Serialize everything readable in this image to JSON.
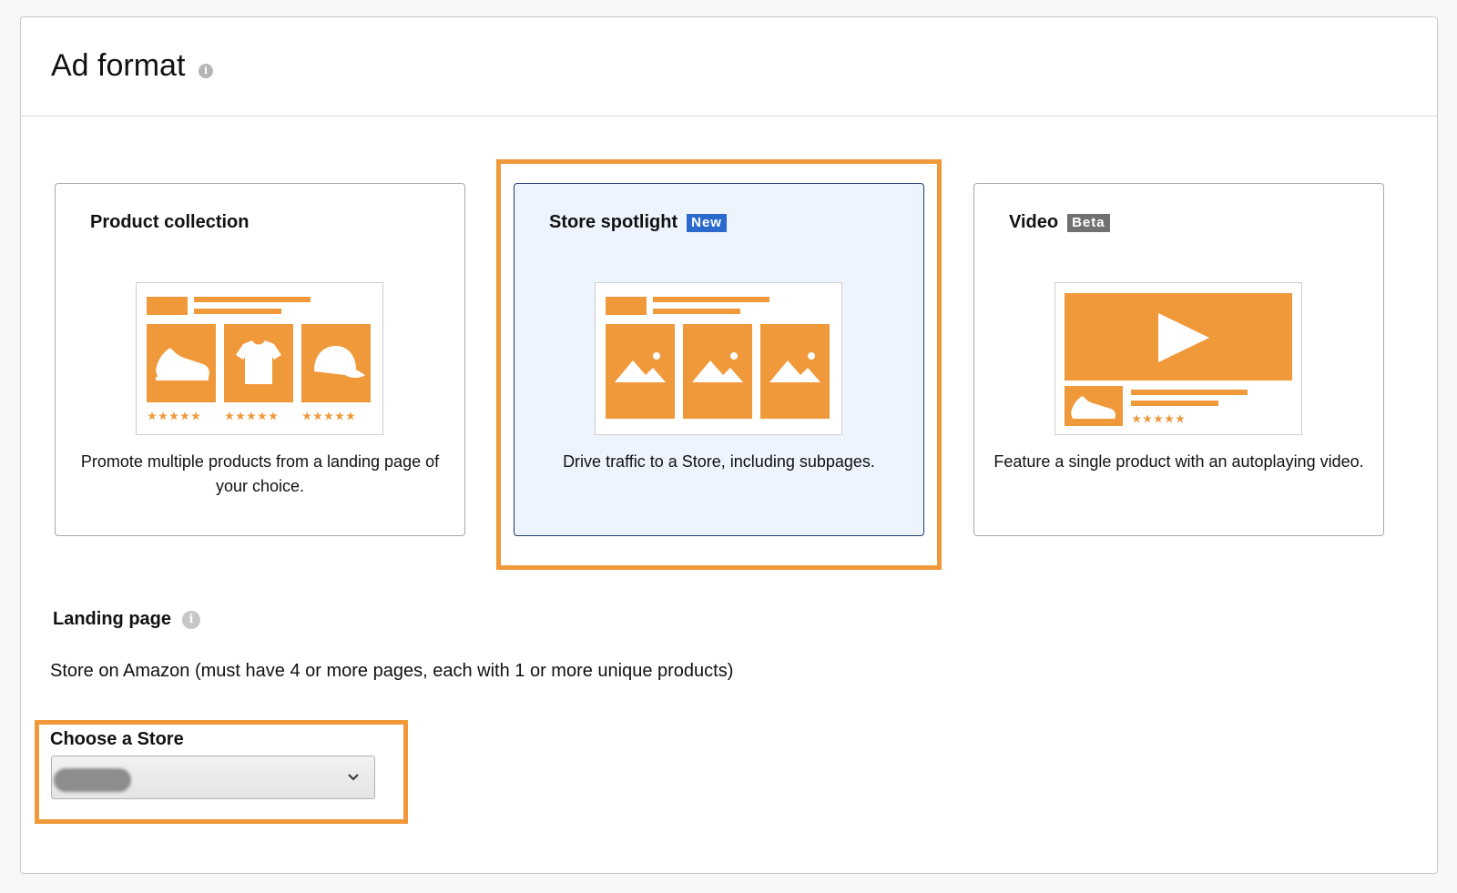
{
  "header": {
    "title": "Ad format"
  },
  "cards": [
    {
      "title": "Product collection",
      "badge": "",
      "description": "Promote multiple products from a landing page of your choice.",
      "selected": false
    },
    {
      "title": "Store spotlight",
      "badge": "New",
      "description": "Drive traffic to a Store, including subpages.",
      "selected": true
    },
    {
      "title": "Video",
      "badge": "Beta",
      "description": "Feature a single product with an autoplaying video.",
      "selected": false
    }
  ],
  "landing_page": {
    "label": "Landing page",
    "text": "Store on Amazon (must have 4 or more pages, each with 1 or more unique products)"
  },
  "store_select": {
    "label": "Choose a Store",
    "value": ""
  },
  "colors": {
    "accent": "#f0993b",
    "selected_bg": "#edf4fd",
    "selected_border": "#1f3b73",
    "badge_new": "#2a6acd",
    "badge_beta": "#717171"
  },
  "icons": [
    "info-icon",
    "shoe-icon",
    "tshirt-icon",
    "cap-icon",
    "image-icon",
    "play-icon",
    "star-icon",
    "chevron-down-icon"
  ]
}
